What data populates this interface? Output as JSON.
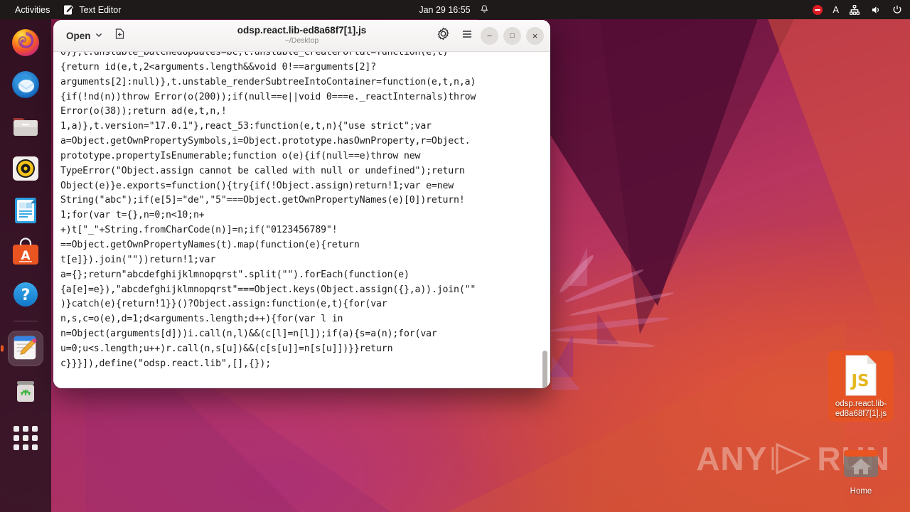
{
  "topbar": {
    "activities": "Activities",
    "app_name": "Text Editor",
    "app_icon": "text-editor-icon",
    "clock": "Jan 29  16:55",
    "bell_icon": "notification-bell-icon",
    "dnd_icon": "do-not-disturb-icon",
    "accessibility": "A",
    "network_icon": "network-icon",
    "volume_icon": "volume-icon",
    "power_icon": "power-icon"
  },
  "dock": {
    "items": [
      {
        "name": "firefox",
        "label": "Firefox"
      },
      {
        "name": "thunderbird",
        "label": "Thunderbird Mail"
      },
      {
        "name": "files",
        "label": "Files"
      },
      {
        "name": "rhythmbox",
        "label": "Rhythmbox"
      },
      {
        "name": "libreoffice-writer",
        "label": "LibreOffice Writer"
      },
      {
        "name": "ubuntu-software",
        "label": "Ubuntu Software"
      },
      {
        "name": "help",
        "label": "Help"
      },
      {
        "name": "text-editor",
        "label": "Text Editor",
        "active": true
      },
      {
        "name": "trash",
        "label": "Trash"
      }
    ],
    "show_apps_label": "Show Applications"
  },
  "window": {
    "open_label": "Open",
    "open_chevron": "chevron-down-icon",
    "new_tab_icon": "new-document-icon",
    "title": "odsp.react.lib-ed8a68f7[1].js",
    "subtitle": "~/Desktop",
    "gear_icon": "gear-icon",
    "menu_icon": "hamburger-menu-icon",
    "minimize": "–",
    "maximize": "□",
    "close": "×"
  },
  "editor": {
    "content": "0)},t.unstable_batchedUpdates=bc,t.unstable_createPortal=function(e,t)\n{return id(e,t,2<arguments.length&&void 0!==arguments[2]?\narguments[2]:null)},t.unstable_renderSubtreeIntoContainer=function(e,t,n,a)\n{if(!nd(n))throw Error(o(200));if(null==e||void 0===e._reactInternals)throw\nError(o(38));return ad(e,t,n,!\n1,a)},t.version=\"17.0.1\"},react_53:function(e,t,n){\"use strict\";var\na=Object.getOwnPropertySymbols,i=Object.prototype.hasOwnProperty,r=Object.\nprototype.propertyIsEnumerable;function o(e){if(null==e)throw new\nTypeError(\"Object.assign cannot be called with null or undefined\");return\nObject(e)}e.exports=function(){try{if(!Object.assign)return!1;var e=new\nString(\"abc\");if(e[5]=\"de\",\"5\"===Object.getOwnPropertyNames(e)[0])return!\n1;for(var t={},n=0;n<10;n+\n+)t[\"_\"+String.fromCharCode(n)]=n;if(\"0123456789\"!\n==Object.getOwnPropertyNames(t).map(function(e){return\nt[e]}).join(\"\"))return!1;var\na={};return\"abcdefghijklmnopqrst\".split(\"\").forEach(function(e)\n{a[e]=e}),\"abcdefghijklmnopqrst\"===Object.keys(Object.assign({},a)).join(\"\"\n)}catch(e){return!1}}()?Object.assign:function(e,t){for(var\nn,s,c=o(e),d=1;d<arguments.length;d++){for(var l in\nn=Object(arguments[d]))i.call(n,l)&&(c[l]=n[l]);if(a){s=a(n);for(var\nu=0;u<s.length;u++)r.call(n,s[u])&&(c[s[u]]=n[s[u]])}}return\nc}}}]),define(\"odsp.react.lib\",[],{});",
    "scroll_position": "near-bottom"
  },
  "desktop": {
    "icons": [
      {
        "name": "js-file",
        "label": "odsp.react.lib-ed8a68f7[1].js",
        "type": "JS",
        "selected": true
      },
      {
        "name": "home-folder",
        "label": "Home",
        "type": "folder",
        "selected": false
      }
    ]
  },
  "watermark": {
    "text_left": "ANY",
    "text_right": "RUN",
    "play_icon": "play-triangle-icon"
  },
  "colors": {
    "accent": "#e95420",
    "topbar_bg": "#1d1a19",
    "window_bg": "#ffffff",
    "dnd_red": "#e01b24"
  }
}
